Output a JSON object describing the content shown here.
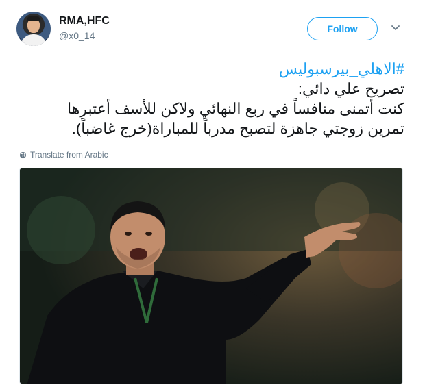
{
  "account": {
    "display_name": "RMA,HFC",
    "handle": "@x0_14"
  },
  "follow": {
    "label": "Follow"
  },
  "tweet": {
    "hashtag": "#الاهلي_بيرسبوليس",
    "lines": [
      "تصريح علي دائي:",
      "كنت أتمنى منافساً في ربع النهائي ولاكن للأسف أعتبرها",
      "تمرين زوجتي جاهزة لتصبح مدرباً للمباراة(خرج غاضباً)."
    ]
  },
  "translate": {
    "label": "Translate from Arabic"
  },
  "icons": {
    "caret": "chevron-down-icon",
    "globe": "globe-icon"
  },
  "colors": {
    "accent": "#1da1f2",
    "secondary_text": "#657786",
    "primary_text": "#14171a"
  }
}
